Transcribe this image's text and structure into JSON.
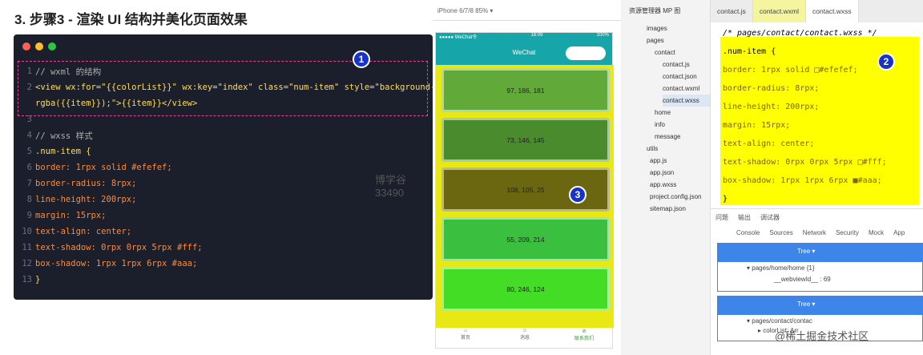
{
  "heading": "3. 步骤3 - 渲染 UI 结构并美化页面效果",
  "colors": {
    "accent": "#1833c7",
    "dashed": "#e04897",
    "highlight": "#ffff00",
    "nav": "#16a5a9"
  },
  "code": [
    [
      "1",
      "// wxml 的结构"
    ],
    [
      "2",
      "<view wx:for=\"{{colorList}}\" wx:key=\"index\" class=\"num-item\" style=\"background-color:"
    ],
    [
      "",
      "rgba({{item}});\">{{item}}</view>"
    ],
    [
      "3",
      ""
    ],
    [
      "4",
      "// wxss 样式"
    ],
    [
      "5",
      ".num-item {"
    ],
    [
      "6",
      "  border: 1rpx solid #efefef;"
    ],
    [
      "7",
      "  border-radius: 8rpx;"
    ],
    [
      "8",
      "  line-height: 200rpx;"
    ],
    [
      "9",
      "  margin: 15rpx;"
    ],
    [
      "10",
      "  text-align: center;"
    ],
    [
      "11",
      "  text-shadow: 0rpx 0rpx 5rpx #fff;"
    ],
    [
      "12",
      "  box-shadow: 1rpx 1rpx 6rpx #aaa;"
    ],
    [
      "13",
      "}"
    ]
  ],
  "watermark": "博学谷 33490",
  "badges": [
    "1",
    "2",
    "3"
  ],
  "sim": {
    "device": "iPhone 6/7/8 85% ▾",
    "status_left": "●●●●● WeChat令",
    "status_time": "18:09",
    "status_right": "100%",
    "title": "WeChat"
  },
  "items": [
    {
      "label": "97, 186, 181",
      "color": "#61aa3a"
    },
    {
      "label": "73, 146, 145",
      "color": "#4a8b2e"
    },
    {
      "label": "108, 105, 25",
      "color": "#6b6710"
    },
    {
      "label": "55, 209, 214",
      "color": "#3abf3e"
    },
    {
      "label": "80, 246, 124",
      "color": "#44dd25"
    }
  ],
  "tabs": [
    "首页",
    "消息",
    "联系我们"
  ],
  "explorer": {
    "title": "资源管理器 MP 图",
    "files": [
      "images",
      "pages",
      "contact",
      "contact.js",
      "contact.json",
      "contact.wxml",
      "contact.wxss",
      "home",
      "info",
      "message",
      "utils",
      "app.js",
      "app.json",
      "app.wxss",
      "project.config.json",
      "sitemap.json"
    ]
  },
  "editor": {
    "tabs": [
      "contact.js",
      "contact.wxml",
      "contact.wxss"
    ],
    "lines": [
      "/* pages/contact/contact.wxss */",
      ".num-item {",
      "  border: 1rpx solid □#efefef;",
      "  border-radius: 8rpx;",
      "  line-height: 200rpx;",
      "  margin: 15rpx;",
      "  text-align: center;",
      "  text-shadow: 0rpx 0rpx 5rpx □#fff;",
      "  box-shadow: 1rpx 1rpx 6rpx ■#aaa;",
      "}"
    ]
  },
  "devtools": {
    "top_tabs": [
      "问题",
      "输出",
      "调试器"
    ],
    "tabs": [
      "Console",
      "Sources",
      "Network",
      "Security",
      "Mock",
      "App"
    ],
    "tree_label": "Tree ▾",
    "tree1": [
      "▾ pages/home/home {1}",
      "__webviewId__ : 69"
    ],
    "tree2": [
      "▾ pages/contact/contac",
      "▸ colorList: Arr"
    ],
    "watermark": "@稀土掘金技术社区"
  }
}
